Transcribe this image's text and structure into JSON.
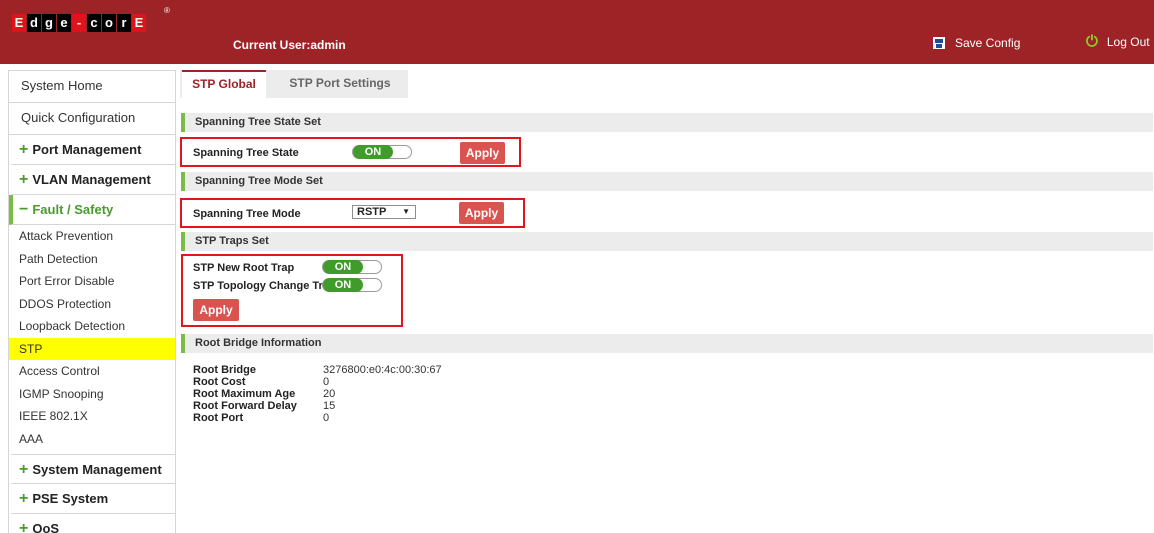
{
  "header": {
    "logo_text": "Edge-corE",
    "logo_chars": [
      "E",
      "d",
      "g",
      "e",
      "-",
      "c",
      "o",
      "r",
      "E"
    ],
    "logo_reg": "®",
    "current_user": "Current User:admin",
    "save_config": "Save Config",
    "logout": "Log Out",
    "colors": {
      "brand": "#9e2327",
      "accent": "#7dbb48"
    },
    "icons": {
      "save": "save-disk-icon",
      "logout": "power-icon"
    }
  },
  "sidebar": {
    "top_items": [
      {
        "label": "System Home"
      },
      {
        "label": "Quick Configuration"
      }
    ],
    "groups": [
      {
        "symbol": "+",
        "label": "Port Management"
      },
      {
        "symbol": "+",
        "label": "VLAN Management"
      },
      {
        "symbol": "−",
        "label": "Fault / Safety"
      }
    ],
    "sub_items": [
      {
        "label": "Attack Prevention"
      },
      {
        "label": "Path Detection"
      },
      {
        "label": "Port Error Disable"
      },
      {
        "label": "DDOS Protection"
      },
      {
        "label": "Loopback Detection"
      },
      {
        "label": "STP"
      },
      {
        "label": "Access Control"
      },
      {
        "label": "IGMP Snooping"
      },
      {
        "label": "IEEE 802.1X"
      },
      {
        "label": "AAA"
      }
    ],
    "active_sub": "STP",
    "groups_after": [
      {
        "symbol": "+",
        "label": "System Management"
      },
      {
        "symbol": "+",
        "label": "PSE System"
      },
      {
        "symbol": "+",
        "label": "QoS"
      }
    ]
  },
  "tabs": [
    {
      "label": "STP Global",
      "active": true
    },
    {
      "label": "STP Port Settings",
      "active": false
    }
  ],
  "sections": {
    "state_set": {
      "title": "Spanning Tree State Set",
      "label": "Spanning Tree State",
      "toggle": "ON",
      "apply": "Apply"
    },
    "mode_set": {
      "title": "Spanning Tree Mode Set",
      "label": "Spanning Tree Mode",
      "selected": "RSTP",
      "arrow": "▼",
      "apply": "Apply"
    },
    "traps_set": {
      "title": "STP Traps Set",
      "new_root_label": "STP New Root Trap",
      "new_root_toggle": "ON",
      "topology_label": "STP Topology Change Trap",
      "topology_toggle": "ON",
      "apply": "Apply"
    },
    "root_bridge": {
      "title": "Root Bridge Information",
      "rows": [
        {
          "label": "Root Bridge",
          "value": "3276800:e0:4c:00:30:67"
        },
        {
          "label": "Root Cost",
          "value": "0"
        },
        {
          "label": "Root Maximum Age",
          "value": "20"
        },
        {
          "label": "Root Forward Delay",
          "value": "15"
        },
        {
          "label": "Root Port",
          "value": "0"
        }
      ]
    }
  }
}
